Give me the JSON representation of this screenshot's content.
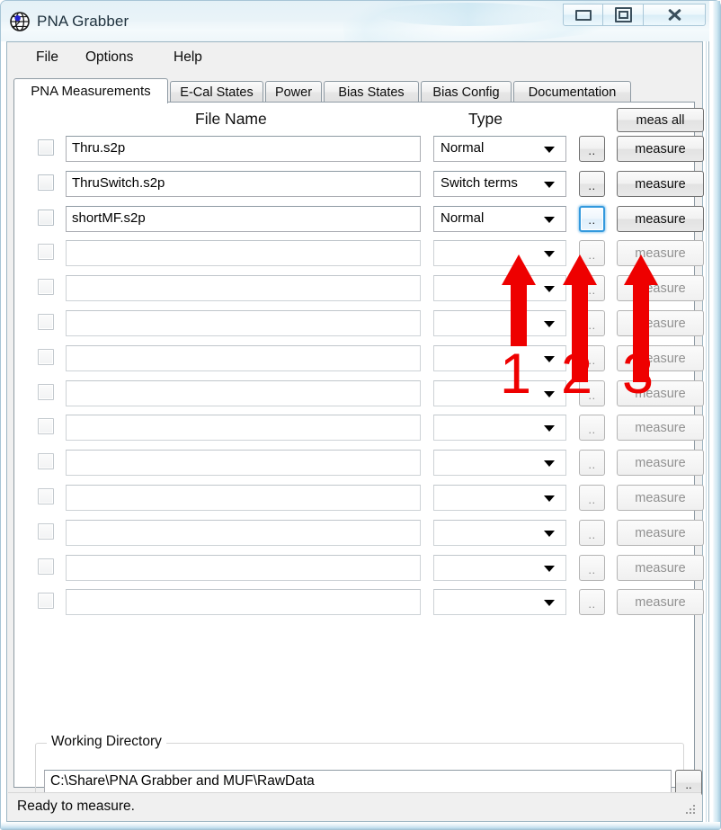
{
  "window": {
    "title": "PNA Grabber",
    "icon": "globe-icon",
    "minimize_label": "Minimize",
    "maximize_label": "Maximize",
    "close_label": "Close"
  },
  "menu": {
    "items": [
      {
        "label": "File"
      },
      {
        "label": "Options"
      },
      {
        "label": "Help"
      }
    ]
  },
  "tabs": [
    {
      "label": "PNA Measurements",
      "selected": true
    },
    {
      "label": "E-Cal States",
      "selected": false
    },
    {
      "label": "Power",
      "selected": false
    },
    {
      "label": "Bias States",
      "selected": false
    },
    {
      "label": "Bias Config",
      "selected": false
    },
    {
      "label": "Documentation",
      "selected": false
    }
  ],
  "measurements": {
    "headers": {
      "file_name": "File Name",
      "type": "Type"
    },
    "meas_all_label": "meas all",
    "browse_label": "..",
    "measure_label": "measure",
    "type_options": [
      "Normal",
      "Switch terms"
    ],
    "rows": [
      {
        "checked": false,
        "file_name": "Thru.s2p",
        "type": "Normal",
        "enabled": true,
        "browse_focused": false
      },
      {
        "checked": false,
        "file_name": "ThruSwitch.s2p",
        "type": "Switch terms",
        "enabled": true,
        "browse_focused": false
      },
      {
        "checked": false,
        "file_name": "shortMF.s2p",
        "type": "Normal",
        "enabled": true,
        "browse_focused": true
      },
      {
        "checked": false,
        "file_name": "",
        "type": "",
        "enabled": false,
        "browse_focused": false
      },
      {
        "checked": false,
        "file_name": "",
        "type": "",
        "enabled": false,
        "browse_focused": false
      },
      {
        "checked": false,
        "file_name": "",
        "type": "",
        "enabled": false,
        "browse_focused": false
      },
      {
        "checked": false,
        "file_name": "",
        "type": "",
        "enabled": false,
        "browse_focused": false
      },
      {
        "checked": false,
        "file_name": "",
        "type": "",
        "enabled": false,
        "browse_focused": false
      },
      {
        "checked": false,
        "file_name": "",
        "type": "",
        "enabled": false,
        "browse_focused": false
      },
      {
        "checked": false,
        "file_name": "",
        "type": "",
        "enabled": false,
        "browse_focused": false
      },
      {
        "checked": false,
        "file_name": "",
        "type": "",
        "enabled": false,
        "browse_focused": false
      },
      {
        "checked": false,
        "file_name": "",
        "type": "",
        "enabled": false,
        "browse_focused": false
      },
      {
        "checked": false,
        "file_name": "",
        "type": "",
        "enabled": false,
        "browse_focused": false
      },
      {
        "checked": false,
        "file_name": "",
        "type": "",
        "enabled": false,
        "browse_focused": false
      }
    ]
  },
  "working_directory": {
    "legend": "Working Directory",
    "path": "C:\\Share\\PNA Grabber and MUF\\RawData",
    "browse_label": ".."
  },
  "status_bar": {
    "text": "Ready to measure."
  },
  "annotations": {
    "color": "#ee0000",
    "markers": [
      {
        "number": "1",
        "points_at": "type-dropdown-row-3"
      },
      {
        "number": "2",
        "points_at": "browse-button-row-3"
      },
      {
        "number": "3",
        "points_at": "measure-button-row-3"
      }
    ]
  }
}
